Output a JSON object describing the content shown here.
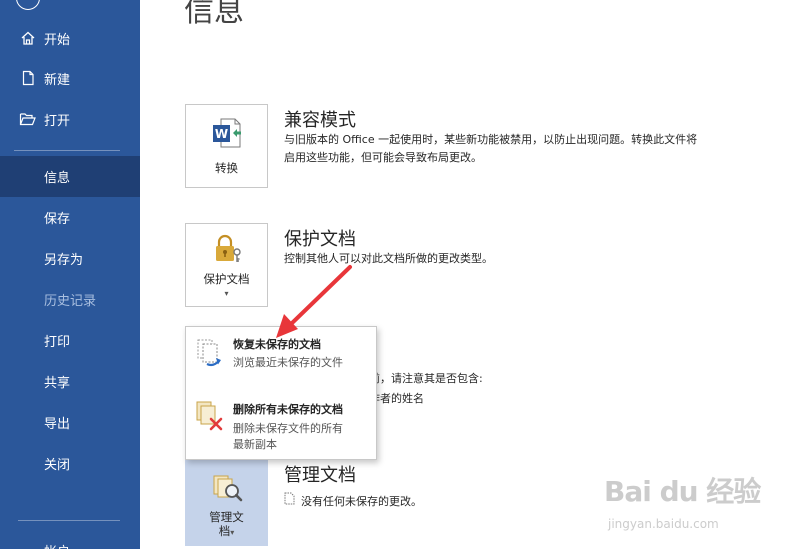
{
  "sidebar": {
    "top_items": [
      {
        "label": "开始",
        "icon": "home-icon"
      },
      {
        "label": "新建",
        "icon": "new-file-icon"
      },
      {
        "label": "打开",
        "icon": "open-folder-icon"
      }
    ],
    "items": [
      {
        "label": "信息",
        "active": true
      },
      {
        "label": "保存"
      },
      {
        "label": "另存为"
      },
      {
        "label": "历史记录",
        "disabled": true
      },
      {
        "label": "打印"
      },
      {
        "label": "共享"
      },
      {
        "label": "导出"
      },
      {
        "label": "关闭"
      }
    ],
    "bottom_item": "帐户"
  },
  "main": {
    "title": "信息",
    "compat": {
      "tile_label": "转换",
      "heading": "兼容模式",
      "desc_line1": "与旧版本的 Office 一起使用时，某些新功能被禁用，以防止出现问题。转换此文件将",
      "desc_line2": "启用这些功能，但可能会导致布局更改。"
    },
    "protect": {
      "tile_label": "保护文档",
      "caret": "▾",
      "heading": "保护文档",
      "desc": "控制其他人可以对此文档所做的更改类型。"
    },
    "inspect": {
      "partial_line1": "前，请注意其是否包含:",
      "partial_line2": "作者的姓名"
    },
    "manage": {
      "tile_label_line1": "管理文",
      "tile_label_line2": "档",
      "caret": "▾",
      "heading": "管理文档",
      "desc": "没有任何未保存的更改。"
    }
  },
  "dropdown": {
    "items": [
      {
        "title": "恢复未保存的文档",
        "desc": "浏览最近未保存的文件"
      },
      {
        "title": "删除所有未保存的文档",
        "desc_line1": "删除未保存文件的所有",
        "desc_line2": "最新副本"
      }
    ]
  },
  "watermark": {
    "text_big": "Bai du 经验",
    "text_small": "jingyan.baidu.com"
  },
  "colors": {
    "sidebar_bg": "#2b579a",
    "sidebar_active": "#1f3f74",
    "sidebar_disabled_text": "#a9bfe0",
    "word_blue": "#2b579a",
    "lock_gold": "#d9a93a",
    "arrow_red": "#e8363a",
    "manage_tile_bg": "#c5d3ea"
  }
}
